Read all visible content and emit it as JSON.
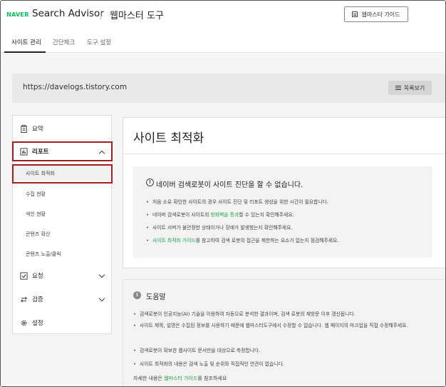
{
  "header": {
    "logo": "NAVER",
    "product": "Search Advisor",
    "section": "웹마스터 도구",
    "guide_button": "웹마스터 가이드"
  },
  "tabs": [
    {
      "label": "사이트 관리",
      "active": true
    },
    {
      "label": "간단체크",
      "active": false
    },
    {
      "label": "도구 설정",
      "active": false
    }
  ],
  "site": {
    "url": "https://davelogs.tistory.com",
    "list_button": "목록보기"
  },
  "sidebar": {
    "summary": "요약",
    "report": "리포트",
    "report_items": [
      "사이트 최적화",
      "수집 현황",
      "색인 현황",
      "콘텐츠 확산",
      "콘텐츠 노출/클릭"
    ],
    "request": "요청",
    "verify": "검증",
    "settings": "설정"
  },
  "main": {
    "title": "사이트 최적화",
    "notice_title": "네이버 검색로봇이 사이트 진단을 할 수 없습니다.",
    "bullets": [
      {
        "text": "처음 소유 확인한 사이트의 경우 사이트 진단 및 리포트 생성을 위한 시간이 필요합니다."
      },
      {
        "pre": "네이버 검색로봇이 사이트의 ",
        "link": "방화벽을 통과",
        "post": "할 수 있는지 확인해주세요."
      },
      {
        "text": "사이트 서버가 불안정한 상태이거나 장애가 발생했는지 확인해주세요."
      },
      {
        "link": "사이트 최적화 가이드",
        "post": "를 참고하여 검색 로봇의 접근을 제한하는 요소가 없는지 점검해주세요."
      }
    ]
  },
  "help": {
    "title": "도움말",
    "items": [
      "검색로봇이 인공지능(AI) 기술을 이용하여 자동으로 분석한 결과이며, 검색 로봇의 재방문 이후 갱신됩니다.",
      "사이트 제목, 설명은 수집된 정보를 사용하기 때문에 웹마스터도구에서 수정할 수 없습니다. 웹 페이지의 마크업을 직접 수정해주세요.",
      "검색로봇이 확보한 웹사이트 문서만을 대상으로 측정합니다.",
      "사이트 최적화의 내용은 검색 노출 및 순위와 직접적인 연관이 없습니다."
    ],
    "footer_pre": "자세한 내용은 ",
    "footer_link": "웹마스터 가이드",
    "footer_post": "를 참조하세요"
  }
}
